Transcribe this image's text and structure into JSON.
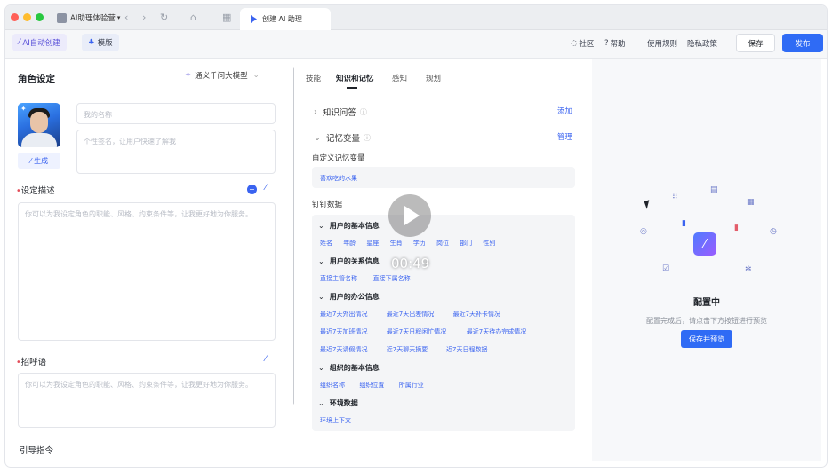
{
  "browser": {
    "tab_a": "AI助理体验营",
    "tab_b": "创建 AI 助理"
  },
  "toolbar": {
    "ai_create": "AI自动创建",
    "template": "模版",
    "community": "社区",
    "help": "帮助",
    "rules": "使用规则",
    "privacy": "隐私政策",
    "save": "保存",
    "publish": "发布"
  },
  "left": {
    "title": "角色设定",
    "model": "通义千问大模型",
    "name_placeholder": "我的名称",
    "signature_placeholder": "个性签名，让用户快速了解我",
    "generate": "生成",
    "desc_label": "设定描述",
    "desc_placeholder": "你可以为我设定角色的职能、风格、约束条件等，让我更好地为你服务。",
    "greeting_label": "招呼语",
    "greeting_placeholder": "你可以为我设定角色的职能、风格、约束条件等，让我更好地为你服务。",
    "guide_label": "引导指令"
  },
  "middle": {
    "tabs": [
      "技能",
      "知识和记忆",
      "感知",
      "规划"
    ],
    "knowledge_qa": "知识问答",
    "add": "添加",
    "memory_vars": "记忆变量",
    "manage": "管理",
    "custom_vars": "自定义记忆变量",
    "custom_var_tag": "喜欢吃的水果",
    "dingtalk_data": "钉钉数据",
    "groups": [
      {
        "title": "用户的基本信息",
        "rows": [
          [
            "姓名",
            "年龄",
            "星座",
            "生肖",
            "学历",
            "岗位",
            "部门",
            "性别"
          ]
        ]
      },
      {
        "title": "用户的关系信息",
        "rows": [
          [
            "直接主管名称",
            "直接下属名称"
          ]
        ]
      },
      {
        "title": "用户的办公信息",
        "rows": [
          [
            "最近7天外出情况",
            "最近7天出差情况",
            "最近7天补卡情况"
          ],
          [
            "最近7天加班情况",
            "最近7天日程闲忙情况",
            "最近7天待办完成情况"
          ],
          [
            "最近7天请假情况",
            "近7天聊天摘要",
            "近7天日程数据"
          ]
        ]
      },
      {
        "title": "组织的基本信息",
        "rows": [
          [
            "组织名称",
            "组织位置",
            "所属行业"
          ]
        ]
      },
      {
        "title": "环境数据",
        "rows": [
          [
            "环境上下文"
          ]
        ]
      }
    ]
  },
  "video": {
    "time": "00:49"
  },
  "right": {
    "title": "配置中",
    "desc": "配置完成后，请点击下方按钮进行预览",
    "button": "保存并预览"
  }
}
